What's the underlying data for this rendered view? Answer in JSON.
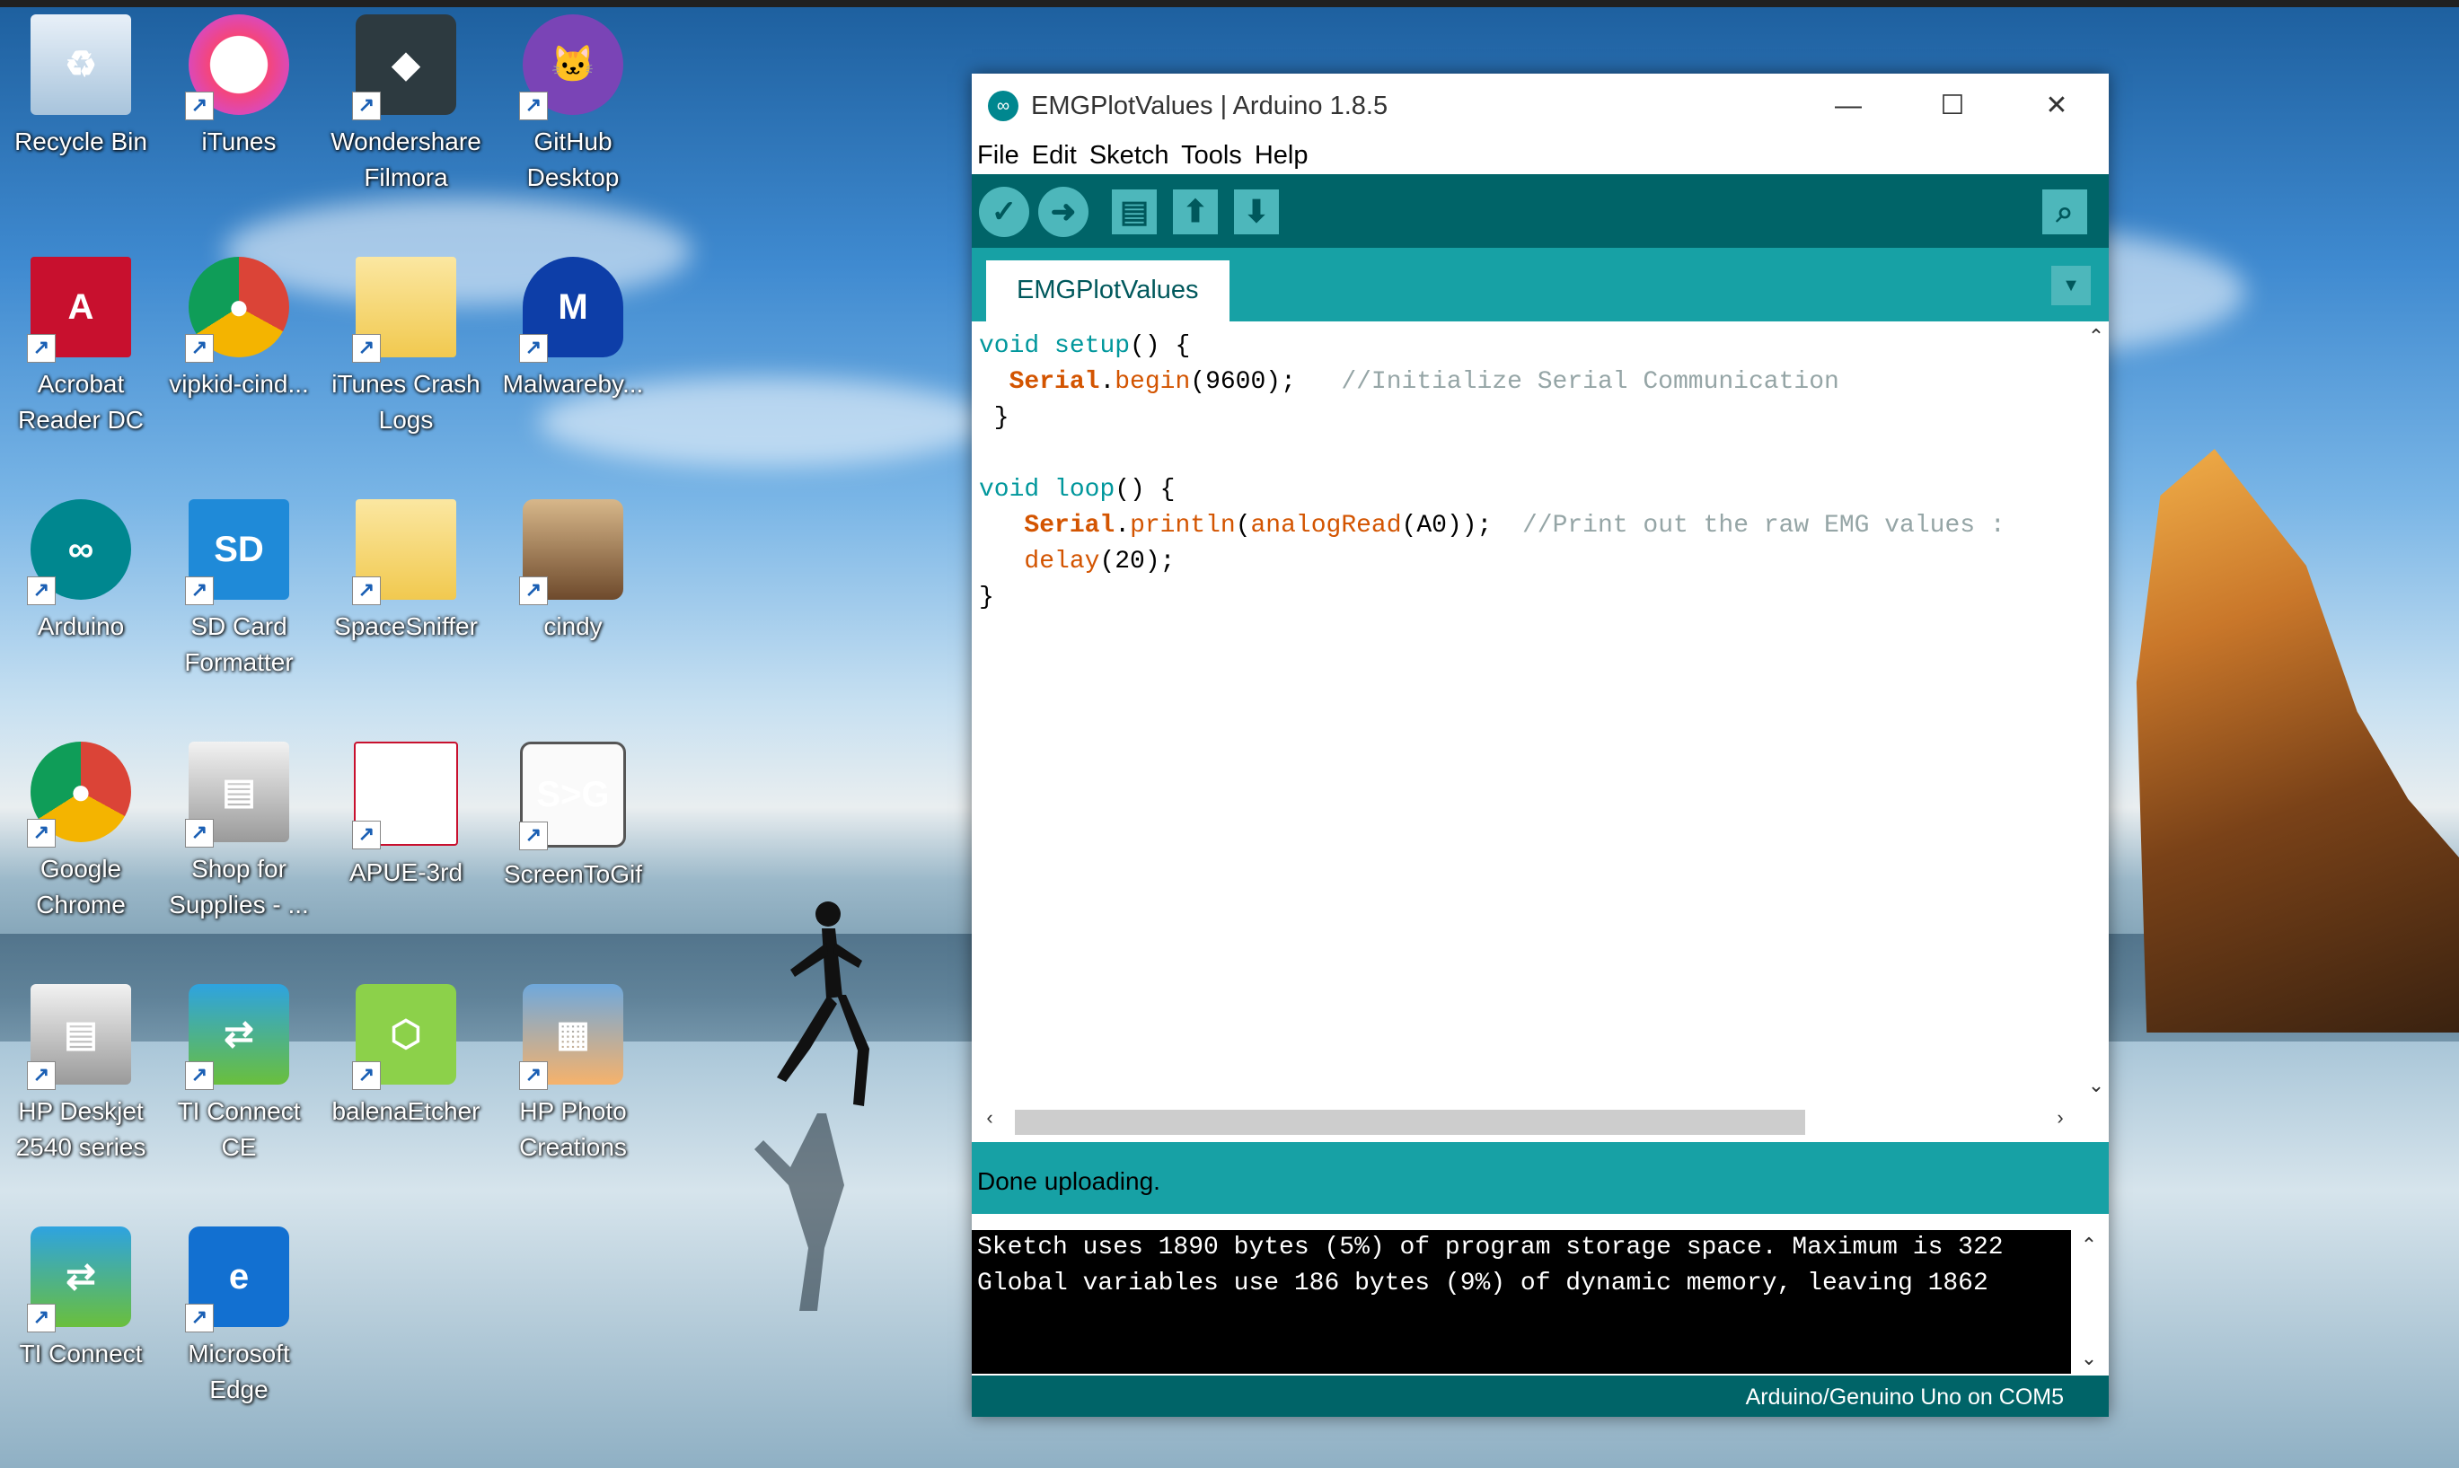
{
  "desktop": {
    "icons": [
      {
        "label": "Recycle Bin",
        "icon": "recycle-bin-icon"
      },
      {
        "label": "iTunes",
        "icon": "itunes-icon"
      },
      {
        "label": "Wondershare Filmora",
        "icon": "filmora-icon"
      },
      {
        "label": "GitHub Desktop",
        "icon": "github-icon"
      },
      {
        "label": "Acrobat Reader DC",
        "icon": "acrobat-icon"
      },
      {
        "label": "vipkid-cind...",
        "icon": "chrome-icon"
      },
      {
        "label": "iTunes Crash Logs",
        "icon": "folder-icon"
      },
      {
        "label": "Malwareby...",
        "icon": "malwarebytes-icon"
      },
      {
        "label": "Arduino",
        "icon": "arduino-icon"
      },
      {
        "label": "SD Card Formatter",
        "icon": "sd-card-icon"
      },
      {
        "label": "SpaceSniffer",
        "icon": "folder-icon"
      },
      {
        "label": "cindy",
        "icon": "photo-icon"
      },
      {
        "label": "Google Chrome",
        "icon": "chrome-icon"
      },
      {
        "label": "Shop for Supplies - ...",
        "icon": "printer-icon"
      },
      {
        "label": "APUE-3rd",
        "icon": "pdf-icon"
      },
      {
        "label": "ScreenToGif",
        "icon": "screentogif-icon"
      },
      {
        "label": "HP Deskjet 2540 series",
        "icon": "printer-icon"
      },
      {
        "label": "TI Connect CE",
        "icon": "ti-connect-icon"
      },
      {
        "label": "balenaEtcher",
        "icon": "etcher-icon"
      },
      {
        "label": "HP Photo Creations",
        "icon": "photo-creations-icon"
      },
      {
        "label": "TI Connect",
        "icon": "ti-connect-icon"
      },
      {
        "label": "Microsoft Edge",
        "icon": "edge-icon"
      }
    ]
  },
  "window": {
    "title": "EMGPlotValues | Arduino 1.8.5",
    "controls": {
      "minimize": "—",
      "maximize": "☐",
      "close": "✕"
    },
    "menu": [
      "File",
      "Edit",
      "Sketch",
      "Tools",
      "Help"
    ],
    "toolbar": {
      "verify": "✓",
      "upload": "➜",
      "new": "▤",
      "open": "⬆",
      "save": "⬇",
      "serial_monitor": "⌕"
    },
    "tab": "EMGPlotValues",
    "code": {
      "l1_kw": "void",
      "l1_fn": "setup",
      "l1_rest": "() {",
      "l2_obj": "Serial",
      "l2_dot": ".",
      "l2_fn": "begin",
      "l2_args": "(9600);",
      "l2_cm": "//Initialize Serial Communication",
      "l3": " }",
      "l5_kw": "void",
      "l5_fn": "loop",
      "l5_rest": "() {",
      "l6_obj": "Serial",
      "l6_dot": ".",
      "l6_fn": "println",
      "l6_p1": "(",
      "l6_fn2": "analogRead",
      "l6_args": "(A0));",
      "l6_cm": "//Print out the raw EMG values :",
      "l7_fn": "delay",
      "l7_args": "(20);",
      "l8": "}"
    },
    "status": "Done uploading.",
    "console": [
      "Sketch uses 1890 bytes (5%) of program storage space. Maximum is 322",
      "Global variables use 186 bytes (9%) of dynamic memory, leaving 1862"
    ],
    "board": "Arduino/Genuino Uno on COM5"
  }
}
